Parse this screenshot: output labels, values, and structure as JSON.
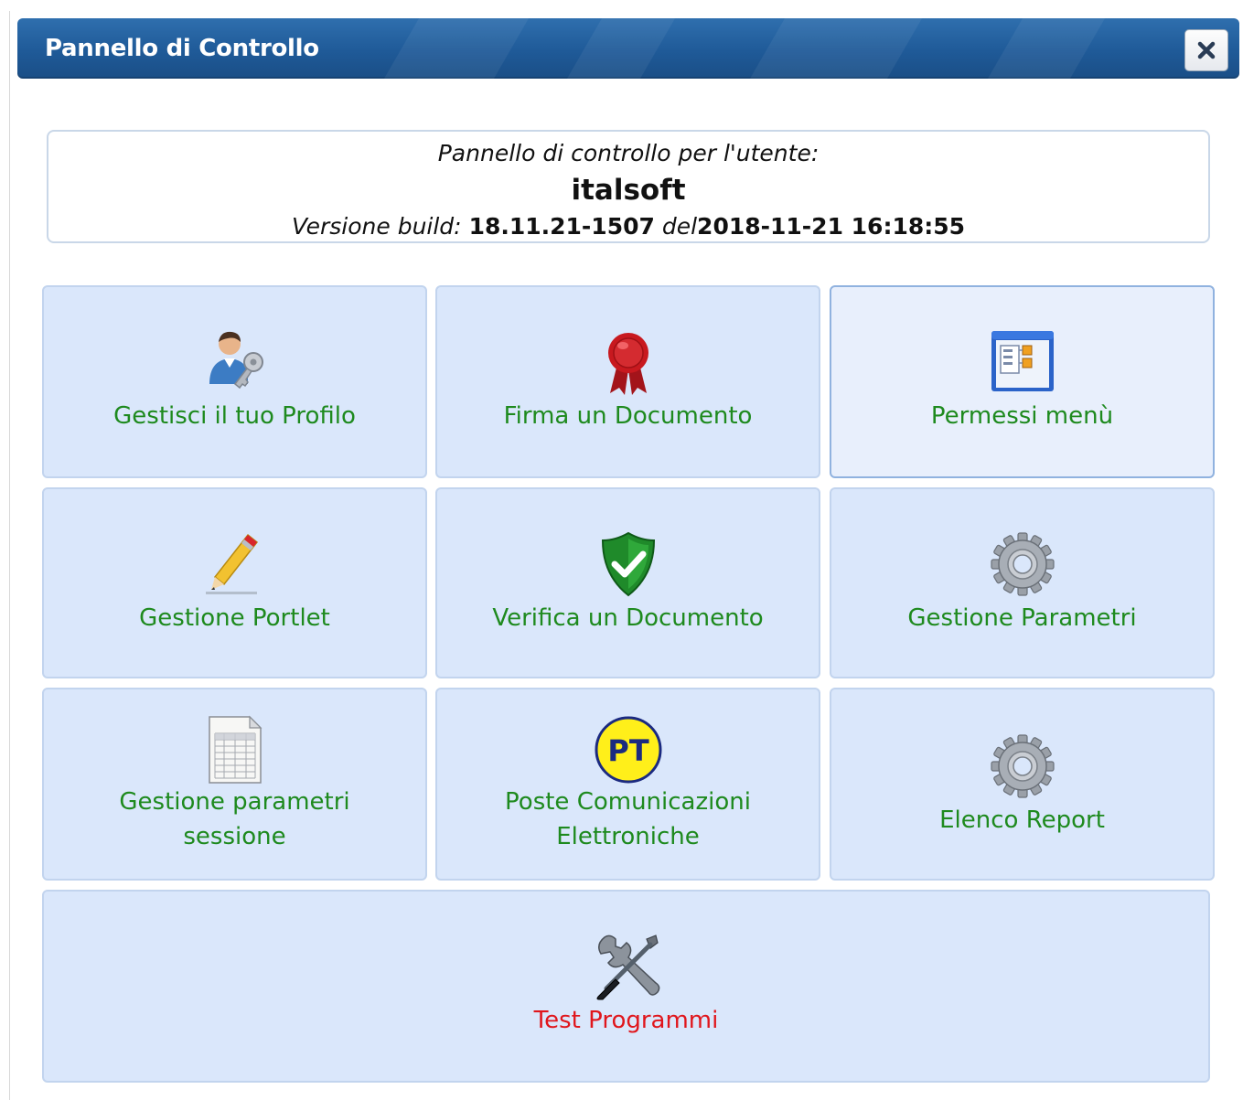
{
  "window": {
    "title": "Pannello di Controllo",
    "close_icon": "close-icon"
  },
  "info": {
    "user_prompt": "Pannello di controllo per l'utente:",
    "username": "italsoft",
    "version_label": "Versione build:",
    "version": "18.11.21-1507",
    "date_label": "del",
    "date": "2018-11-21 16:18:55"
  },
  "tiles": [
    {
      "label": "Gestisci il tuo Profilo",
      "icon": "user-key-icon"
    },
    {
      "label": "Firma un Documento",
      "icon": "ribbon-seal-icon"
    },
    {
      "label": "Permessi menù",
      "icon": "menu-window-icon"
    },
    {
      "label": "Gestione Portlet",
      "icon": "pencil-icon"
    },
    {
      "label": "Verifica un Documento",
      "icon": "shield-check-icon"
    },
    {
      "label": "Gestione Parametri",
      "icon": "gear-icon"
    },
    {
      "label1": "Gestione parametri",
      "label2": "sessione",
      "icon": "spreadsheet-icon"
    },
    {
      "label1": "Poste Comunicazioni",
      "label2": "Elettroniche",
      "icon": "pt-logo-icon",
      "logo_text": "PT"
    },
    {
      "label": "Elenco Report",
      "icon": "gear-icon"
    },
    {
      "label": "Test Programmi",
      "icon": "tools-icon"
    }
  ],
  "colors": {
    "titlebar": "#1f5a98",
    "tile_bg": "#dae7fb",
    "tile_label": "#1e8a1e",
    "tile_label_alert": "#e0161c"
  }
}
